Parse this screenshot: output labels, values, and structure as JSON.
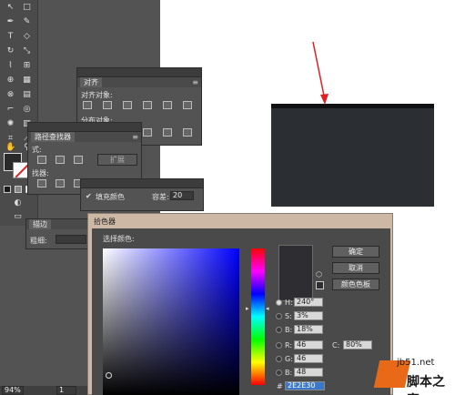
{
  "align_panel": {
    "tab": "对齐",
    "align_objects_label": "对齐对象:",
    "distribute_objects_label": "分布对象:"
  },
  "pathfinder_panel": {
    "tab": "路径查找器",
    "shape_mode_label": "式:",
    "pathfinder_label": "找器:",
    "expand_button": "扩展"
  },
  "appearance_panel": {
    "fill_color_label": "填充颜色",
    "tolerance_label": "容差:",
    "tolerance_value": "20"
  },
  "stroke_panel": {
    "tab": "描边",
    "weight_label": "粗细:"
  },
  "color_picker": {
    "title": "拾色器",
    "select_color_label": "选择颜色:",
    "ok_button": "确定",
    "cancel_button": "取消",
    "swatches_button": "颜色色板",
    "fields": [
      {
        "label": "H:",
        "value": "240°"
      },
      {
        "label": "S:",
        "value": "3%"
      },
      {
        "label": "B:",
        "value": "18%"
      },
      {
        "label": "R:",
        "value": "46"
      },
      {
        "label": "G:",
        "value": "46"
      },
      {
        "label": "B:",
        "value": "48"
      }
    ],
    "c_label": "C:",
    "c_value": "80%",
    "hex_prefix": "#",
    "hex_value": "2E2E30"
  },
  "status_bar": {
    "zoom": "94%",
    "page": "1"
  },
  "watermark": {
    "url": "jb51.net",
    "name": "脚本之家"
  },
  "colors": {
    "annotation_arrow": "#e02020",
    "selected_color": "#2e2e30",
    "artboard_rect": "#2b2e32"
  }
}
